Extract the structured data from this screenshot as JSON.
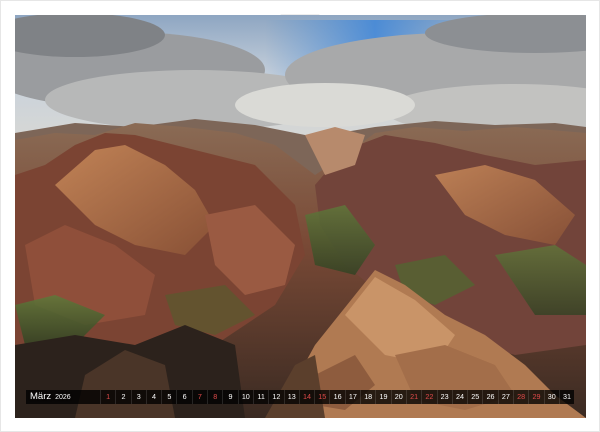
{
  "calendar": {
    "month": "März",
    "year": "2026",
    "days": [
      "1",
      "2",
      "3",
      "4",
      "5",
      "6",
      "7",
      "8",
      "9",
      "10",
      "11",
      "12",
      "13",
      "14",
      "15",
      "16",
      "17",
      "18",
      "19",
      "20",
      "21",
      "22",
      "23",
      "24",
      "25",
      "26",
      "27",
      "28",
      "29",
      "30",
      "31"
    ],
    "weekend_days": [
      "1",
      "7",
      "8",
      "14",
      "15",
      "21",
      "22",
      "28",
      "29"
    ]
  },
  "photo": {
    "subject": "canyon-landscape"
  },
  "colors": {
    "weekend": "#e04a4a",
    "strip": "#000000",
    "text": "#ffffff"
  }
}
